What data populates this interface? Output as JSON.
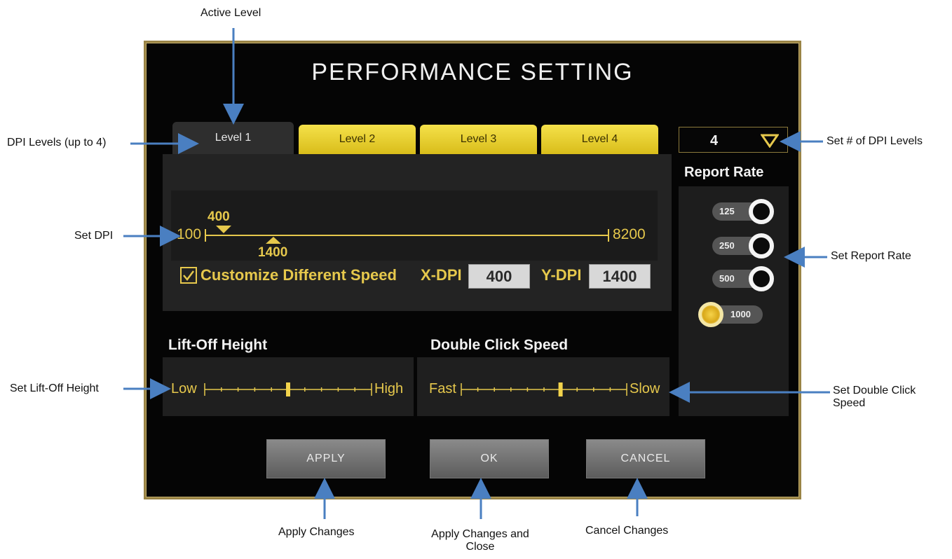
{
  "annotations": {
    "active_level": "Active Level",
    "dpi_levels": "DPI Levels (up to 4)",
    "set_dpi": "Set DPI",
    "set_lift_off": "Set Lift-Off Height",
    "set_num_levels": "Set # of DPI Levels",
    "set_report_rate": "Set Report Rate",
    "set_double_click": "Set Double Click Speed",
    "apply_changes": "Apply Changes",
    "apply_close": "Apply Changes and Close",
    "cancel_changes": "Cancel Changes"
  },
  "window": {
    "title": "PERFORMANCE SETTING"
  },
  "tabs": [
    {
      "label": "Level 1",
      "active": true
    },
    {
      "label": "Level 2",
      "active": false
    },
    {
      "label": "Level 3",
      "active": false
    },
    {
      "label": "Level 4",
      "active": false
    }
  ],
  "dpi_levels_select": {
    "value": "4"
  },
  "dpi": {
    "min_label": "100",
    "max_label": "8200",
    "min": 100,
    "max": 8200,
    "x_marker": "400",
    "y_marker": "1400",
    "customize_label": "Customize Different Speed",
    "customize_checked": true,
    "x_dpi_label": "X-DPI",
    "x_dpi_value": "400",
    "y_dpi_label": "Y-DPI",
    "y_dpi_value": "1400"
  },
  "report_rate": {
    "title": "Report Rate",
    "options": [
      "125",
      "250",
      "500",
      "1000"
    ],
    "selected": "1000"
  },
  "lift_off": {
    "title": "Lift-Off Height",
    "low_label": "Low",
    "high_label": "High",
    "level_fraction": 0.5
  },
  "double_click": {
    "title": "Double Click Speed",
    "fast_label": "Fast",
    "slow_label": "Slow",
    "level_fraction": 0.6
  },
  "buttons": {
    "apply": "APPLY",
    "ok": "OK",
    "cancel": "CANCEL"
  },
  "colors": {
    "accent_yellow": "#e6c84c",
    "panel_bg": "#050505",
    "arrow_blue": "#4a7fc1"
  }
}
